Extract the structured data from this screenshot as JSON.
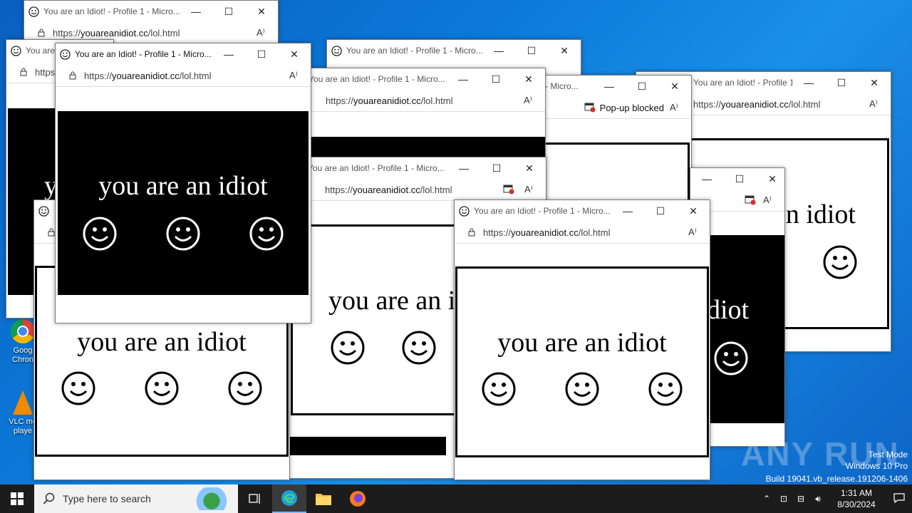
{
  "desktop": {
    "icons": [
      {
        "label": "Goog\nChron"
      },
      {
        "label": "VLC me\nplaye"
      }
    ],
    "watermark": {
      "brand": "ANY RUN",
      "test_mode": "Test Mode",
      "os": "Windows 10 Pro",
      "build": "Build 19041.vb_release.191206-1406"
    }
  },
  "popup": {
    "title": "You are an Idiot! - Profile 1 - Micro...",
    "url_prefix": "https://",
    "url_domain": "youareanidiot.cc",
    "url_path": "/lol.html",
    "message": "you are an idiot",
    "popup_blocked": "Pop-up blocked",
    "minimize_glyph": "—",
    "maximize_glyph": "☐",
    "close_glyph": "✕"
  },
  "taskbar": {
    "search_placeholder": "Type here to search",
    "time": "1:31 AM",
    "date": "8/30/2024"
  },
  "colors": {
    "accent": "#0b78d8",
    "taskbar": "#1c1c1c"
  }
}
